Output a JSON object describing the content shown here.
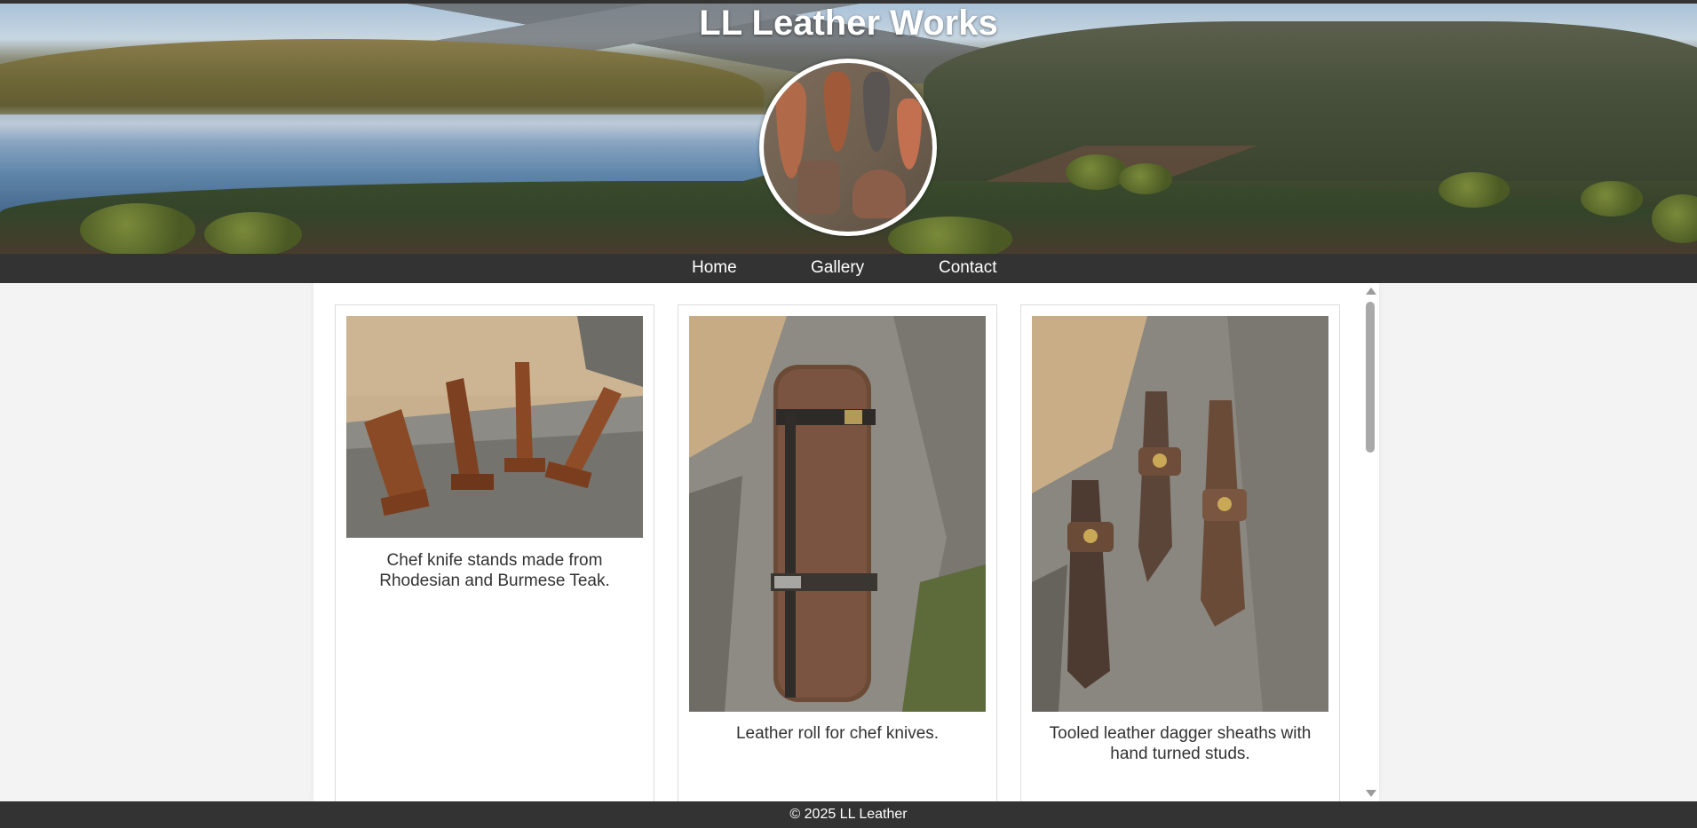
{
  "site": {
    "title": "LL Leather Works",
    "logo_alt": "Leather sheaths collage"
  },
  "nav": {
    "items": [
      {
        "label": "Home"
      },
      {
        "label": "Gallery"
      },
      {
        "label": "Contact"
      }
    ]
  },
  "gallery": {
    "cards": [
      {
        "caption": "Chef knife stands made from Rhodesian and Burmese Teak.",
        "image": "wooden knife stands on driftwood"
      },
      {
        "caption": "Leather roll for chef knives.",
        "image": "rolled brown leather knife roll with straps"
      },
      {
        "caption": "Tooled leather dagger sheaths with hand turned studs.",
        "image": "three tooled leather dagger sheaths"
      }
    ]
  },
  "footer": {
    "text": "© 2025 LL Leather"
  },
  "colors": {
    "nav_bg": "#333333",
    "page_bg": "#f3f3f3",
    "text": "#333333"
  }
}
